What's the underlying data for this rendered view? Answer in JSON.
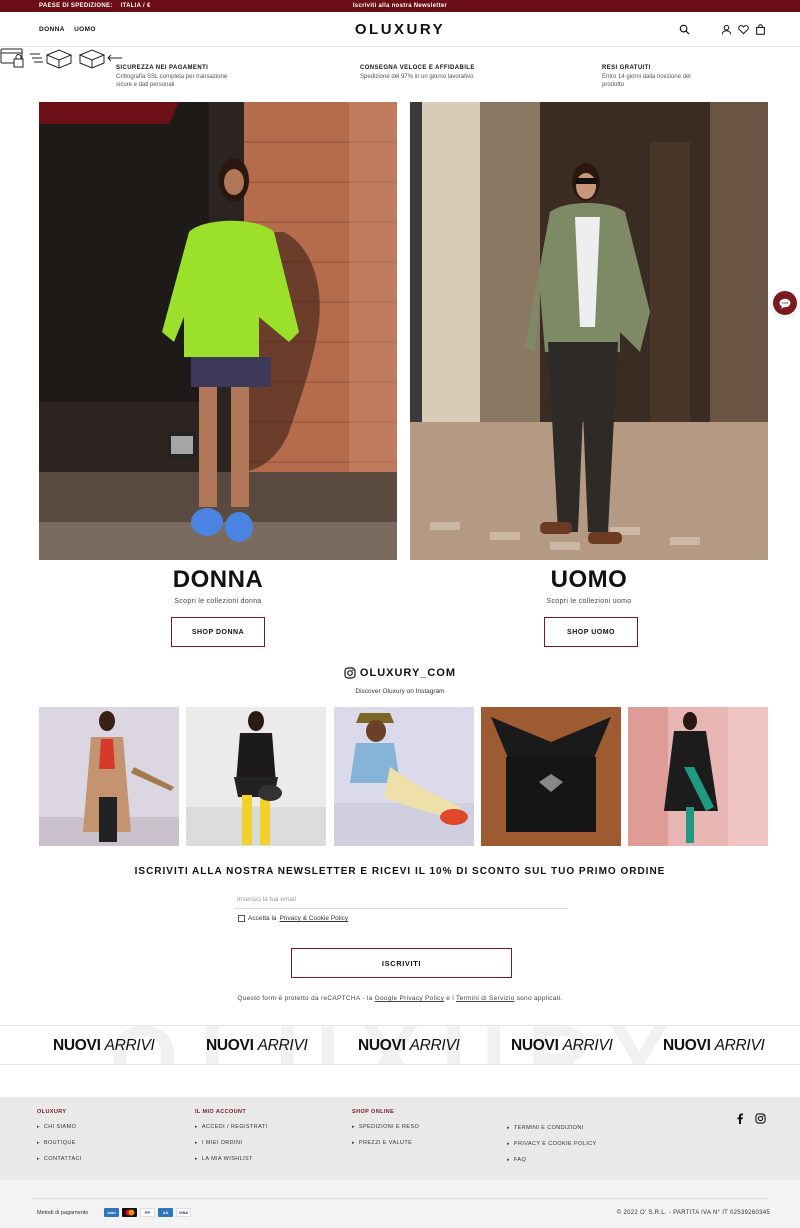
{
  "topbar": {
    "ship_label": "PAESE DI SPEDIZIONE:",
    "ship_value": "ITALIA / €",
    "newsletter": "Iscriviti alla nostra Newsletter",
    "bg": "#6b0d14"
  },
  "header": {
    "nav": [
      "DONNA",
      "UOMO"
    ],
    "logo": "OLUXURY",
    "icons": [
      "search-icon",
      "account-icon",
      "wishlist-icon",
      "cart-icon"
    ]
  },
  "features": [
    {
      "icon": "card-lock-icon",
      "title": "SICUREZZA NEI PAGAMENTI",
      "text1": "Crittografia SSL completa per transazione",
      "text2": "sicure e dati personali"
    },
    {
      "icon": "fast-box-icon",
      "title": "CONSEGNA VELOCE E AFFIDABILE",
      "text1": "Spedizione del 97% in un giorno lavorativo",
      "text2": ""
    },
    {
      "icon": "return-box-icon",
      "title": "RESI GRATUITI",
      "text1": "Entro 14 giorni dalla ricezione del",
      "text2": "prodotto"
    }
  ],
  "categories": [
    {
      "title": "DONNA",
      "subtitle": "Scopri le collezioni donna",
      "button": "SHOP DONNA"
    },
    {
      "title": "UOMO",
      "subtitle": "Scopri le collezioni uomo",
      "button": "SHOP UOMO"
    }
  ],
  "instagram": {
    "handle": "OLUXURY_COM",
    "caption": "Discover Oluxury on Instagram"
  },
  "newsletter": {
    "title": "ISCRIVITI ALLA NOSTRA NEWSLETTER E RICEVI IL 10% DI SCONTO SUL TUO PRIMO ORDINE",
    "placeholder": "Inserisci la tua email",
    "consent_prefix": "Accetta la",
    "consent_link": "Privacy & Cookie Policy",
    "button": "ISCRIVITI",
    "recaptcha_pre": "Questo form è protetto da reCAPTCHA - la",
    "recaptcha_link1": "Google Privacy Policy",
    "recaptcha_mid": "e i",
    "recaptcha_link2": "Termini di Servizio",
    "recaptcha_post": "sono applicati."
  },
  "marquee": {
    "bg_word": "OLUXURY",
    "bold": "NUOVI",
    "italic": "ARRIVI"
  },
  "footer": {
    "columns": [
      {
        "title": "OLUXURY",
        "items": [
          "CHI SIAMO",
          "BOUTIQUE",
          "CONTATTACI"
        ]
      },
      {
        "title": "IL MIO ACCOUNT",
        "items": [
          "ACCEDI / REGISTRATI",
          "I MIEI ORDINI",
          "LA MIA WISHLIST"
        ]
      },
      {
        "title": "SHOP ONLINE",
        "items": [
          "SPEDIZIONI E RESO",
          "PREZZI E VALUTE"
        ]
      },
      {
        "title": "",
        "items": [
          "TERMINI E CONDIZIONI",
          "PRIVACY E COOKIE POLICY",
          "FAQ"
        ]
      }
    ],
    "social": [
      "facebook-icon",
      "instagram-icon"
    ],
    "payments_label": "Metodi di pagamento",
    "cards": [
      "AMEX",
      "MC",
      "PP",
      "AX",
      "VISA"
    ],
    "copyright": "© 2022 O' S.R.L. - PARTITA IVA N° IT 02539260345"
  },
  "accent": "#7a1a22"
}
